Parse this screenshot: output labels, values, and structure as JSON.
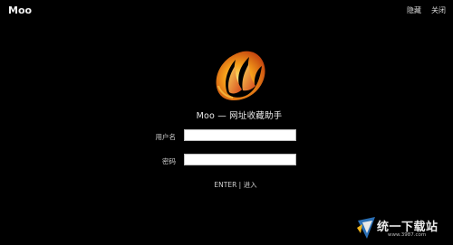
{
  "window": {
    "app_title": "Moo",
    "actions": {
      "hide_label": "隐藏",
      "close_label": "关闭"
    }
  },
  "brand": {
    "subtitle": "Moo — 网址收藏助手",
    "logo_icon": "flame-logo-icon"
  },
  "login": {
    "username_label": "用户名",
    "username_value": "",
    "password_label": "密码",
    "password_value": "",
    "enter_label": "ENTER | 进入"
  },
  "watermark": {
    "text": "统一下载站",
    "url": "www.3987.com",
    "icon": "logo-mark-icon"
  },
  "colors": {
    "background": "#000000",
    "text": "#ffffff",
    "flame_outer": "#f7a21b",
    "flame_inner": "#c73a12"
  }
}
